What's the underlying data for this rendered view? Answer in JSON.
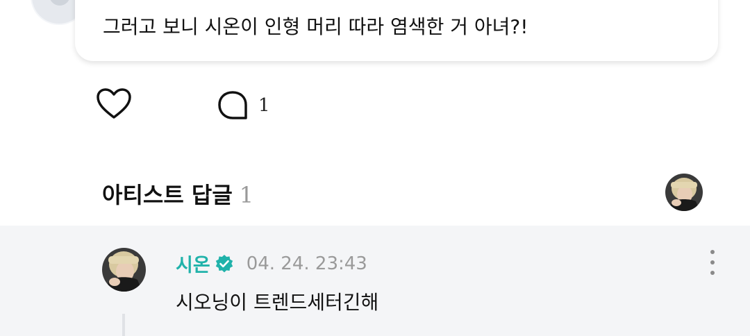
{
  "comment": {
    "text": "그러고 보니 시온이 인형 머리 따라 염색한 거 아녀?!"
  },
  "actions": {
    "like_icon": "heart-icon",
    "reply_icon": "speech-bubble-icon",
    "reply_count": "1"
  },
  "artist_replies": {
    "title": "아티스트 답글",
    "count": "1"
  },
  "reply": {
    "author": "시온",
    "verified_icon": "verified-badge-icon",
    "timestamp": "04. 24. 23:43",
    "text": "시오닝이 트렌드세터긴해",
    "more_icon": "more-vertical-icon"
  },
  "colors": {
    "artist_name": "#20b2aa",
    "reply_background": "#f4f5f7",
    "muted_text": "#9a9a9a"
  }
}
